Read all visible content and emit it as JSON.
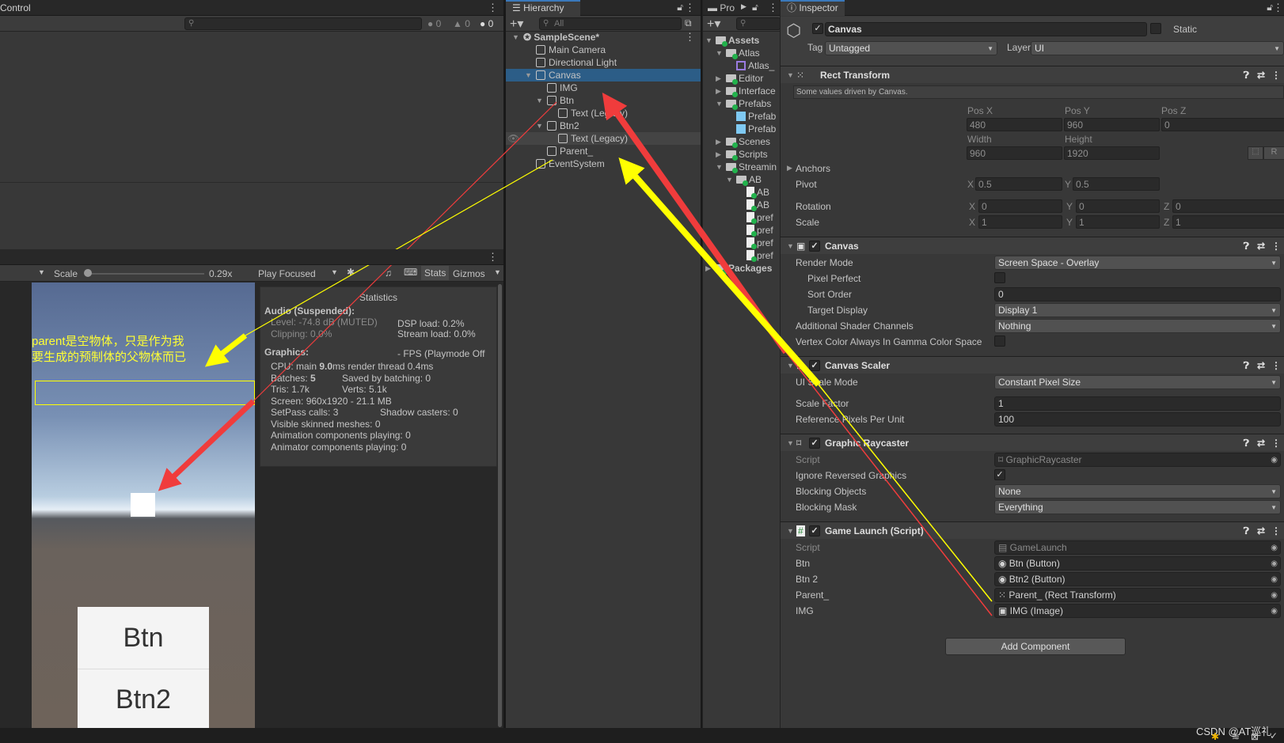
{
  "console": {
    "title": "Control",
    "counts": {
      "info": "0",
      "warning": "0",
      "error": "0"
    }
  },
  "game": {
    "scale_label": "Scale",
    "scale_value": "0.29x",
    "scale_fraction": 0.0,
    "play_mode": "Play Focused",
    "stats_label": "Stats",
    "gizmos_label": "Gizmos",
    "annotation_line1": "parent是空物体，只是作为我",
    "annotation_line2": "要生成的预制体的父物体而已",
    "btn1": "Btn",
    "btn2": "Btn2",
    "stats": {
      "title": "Statistics",
      "audio": "Audio (Suspended):",
      "level": "Level: -74.8 dB (MUTED)",
      "clipping": "Clipping: 0.0%",
      "dsp": "DSP load: 0.2%",
      "stream": "Stream load: 0.0%",
      "graphics": "Graphics:",
      "fps": "- FPS (Playmode Off",
      "cpu_a": "CPU: main ",
      "cpu_b": "9.0",
      "cpu_c": "ms  render thread 0.4ms",
      "batches_a": "Batches: ",
      "batches_b": "5",
      "saved": "Saved by batching: 0",
      "tris": "Tris: 1.7k",
      "verts": "Verts: 5.1k",
      "screen": "Screen: 960x1920 - 21.1 MB",
      "setpass": "SetPass calls: 3",
      "shadow": "Shadow casters: 0",
      "skinned": "Visible skinned meshes: 0",
      "anim": "Animation components playing: 0",
      "animator": "Animator components playing: 0"
    }
  },
  "hierarchy": {
    "title": "Hierarchy",
    "search_placeholder": "All",
    "items": [
      {
        "label": "SampleScene*",
        "depth": 0,
        "fold": "open",
        "scene": true
      },
      {
        "label": "Main Camera",
        "depth": 1
      },
      {
        "label": "Directional Light",
        "depth": 1
      },
      {
        "label": "Canvas",
        "depth": 1,
        "fold": "open",
        "selected": true
      },
      {
        "label": "IMG",
        "depth": 2
      },
      {
        "label": "Btn",
        "depth": 2,
        "fold": "open"
      },
      {
        "label": "Text (Legacy)",
        "depth": 3
      },
      {
        "label": "Btn2",
        "depth": 2,
        "fold": "open"
      },
      {
        "label": "Text (Legacy)",
        "depth": 3,
        "hover": true
      },
      {
        "label": "Parent_",
        "depth": 2
      },
      {
        "label": "EventSystem",
        "depth": 1
      }
    ]
  },
  "project": {
    "title": "Pro",
    "items": [
      {
        "label": "Assets",
        "depth": 0,
        "fold": "open",
        "kind": "folder",
        "bold": true
      },
      {
        "label": "Atlas",
        "depth": 1,
        "fold": "open",
        "kind": "folder"
      },
      {
        "label": "Atlas_",
        "depth": 2,
        "kind": "atlas"
      },
      {
        "label": "Editor",
        "depth": 1,
        "fold": "closed",
        "kind": "folder"
      },
      {
        "label": "Interface",
        "depth": 1,
        "fold": "closed",
        "kind": "folder"
      },
      {
        "label": "Prefabs",
        "depth": 1,
        "fold": "open",
        "kind": "folder"
      },
      {
        "label": "Prefab",
        "depth": 2,
        "kind": "prefab"
      },
      {
        "label": "Prefab",
        "depth": 2,
        "kind": "prefab"
      },
      {
        "label": "Scenes",
        "depth": 1,
        "fold": "closed",
        "kind": "folder"
      },
      {
        "label": "Scripts",
        "depth": 1,
        "fold": "closed",
        "kind": "folder"
      },
      {
        "label": "Streamin",
        "depth": 1,
        "fold": "open",
        "kind": "folder"
      },
      {
        "label": "AB",
        "depth": 2,
        "fold": "open",
        "kind": "folder"
      },
      {
        "label": "AB",
        "depth": 3,
        "kind": "file"
      },
      {
        "label": "AB",
        "depth": 3,
        "kind": "file"
      },
      {
        "label": "pref",
        "depth": 3,
        "kind": "file"
      },
      {
        "label": "pref",
        "depth": 3,
        "kind": "file"
      },
      {
        "label": "pref",
        "depth": 3,
        "kind": "file"
      },
      {
        "label": "pref",
        "depth": 3,
        "kind": "file"
      },
      {
        "label": "Packages",
        "depth": 0,
        "fold": "closed",
        "kind": "folder",
        "bold": true
      }
    ]
  },
  "inspector": {
    "title": "Inspector",
    "object_name": "Canvas",
    "static_label": "Static",
    "tag_label": "Tag",
    "tag_value": "Untagged",
    "layer_label": "Layer",
    "layer_value": "UI",
    "rect": {
      "title": "Rect Transform",
      "note": "Some values driven by Canvas.",
      "posx_label": "Pos X",
      "posy_label": "Pos Y",
      "posz_label": "Pos Z",
      "posx": "480",
      "posy": "960",
      "posz": "0",
      "width_label": "Width",
      "height_label": "Height",
      "width": "960",
      "height": "1920",
      "anchors": "Anchors",
      "pivot": "Pivot",
      "pivot_x": "0.5",
      "pivot_y": "0.5",
      "rotation": "Rotation",
      "rot_x": "0",
      "rot_y": "0",
      "rot_z": "0",
      "scale": "Scale",
      "scale_x": "1",
      "scale_y": "1",
      "scale_z": "1",
      "r_btn": "R"
    },
    "components": [
      {
        "title": "Canvas",
        "rows": [
          {
            "label": "Render Mode",
            "type": "dd",
            "value": "Screen Space - Overlay"
          },
          {
            "label": "Pixel Perfect",
            "type": "chk",
            "checked": false,
            "indent": true
          },
          {
            "label": "Sort Order",
            "type": "fld",
            "value": "0",
            "indent": true
          },
          {
            "label": "Target Display",
            "type": "dd",
            "value": "Display 1",
            "indent": true
          },
          {
            "label": "Additional Shader Channels",
            "type": "dd",
            "value": "Nothing"
          },
          {
            "label": "Vertex Color Always In Gamma Color Space",
            "type": "chk",
            "checked": false
          }
        ]
      },
      {
        "title": "Canvas Scaler",
        "rows": [
          {
            "label": "UI Scale Mode",
            "type": "dd",
            "value": "Constant Pixel Size",
            "gap": true
          },
          {
            "label": "Scale Factor",
            "type": "fld",
            "value": "1"
          },
          {
            "label": "Reference Pixels Per Unit",
            "type": "fld",
            "value": "100"
          }
        ]
      },
      {
        "title": "Graphic Raycaster",
        "rows": [
          {
            "label": "Script",
            "type": "obj",
            "value": "⌑ GraphicRaycaster",
            "disabled": true
          },
          {
            "label": "Ignore Reversed Graphics",
            "type": "chk",
            "checked": true
          },
          {
            "label": "Blocking Objects",
            "type": "dd",
            "value": "None"
          },
          {
            "label": "Blocking Mask",
            "type": "dd",
            "value": "Everything"
          }
        ]
      },
      {
        "title": "Game Launch (Script)",
        "rows": [
          {
            "label": "Script",
            "type": "obj",
            "value": "▤ GameLaunch",
            "disabled": true
          },
          {
            "label": "Btn",
            "type": "obj",
            "value": "◉ Btn (Button)"
          },
          {
            "label": "Btn 2",
            "type": "obj",
            "value": "◉ Btn2 (Button)"
          },
          {
            "label": "Parent_",
            "type": "obj",
            "value": "⁙ Parent_ (Rect Transform)"
          },
          {
            "label": "IMG",
            "type": "obj",
            "value": "▣ IMG (Image)"
          }
        ]
      }
    ],
    "add_component": "Add Component"
  },
  "watermark": "CSDN @AT巡礼",
  "colors": {
    "selection": "#2c5d87",
    "arrow_red": "#f03c3c",
    "arrow_yellow": "#ffff00",
    "annotation_text": "#ffff33"
  }
}
